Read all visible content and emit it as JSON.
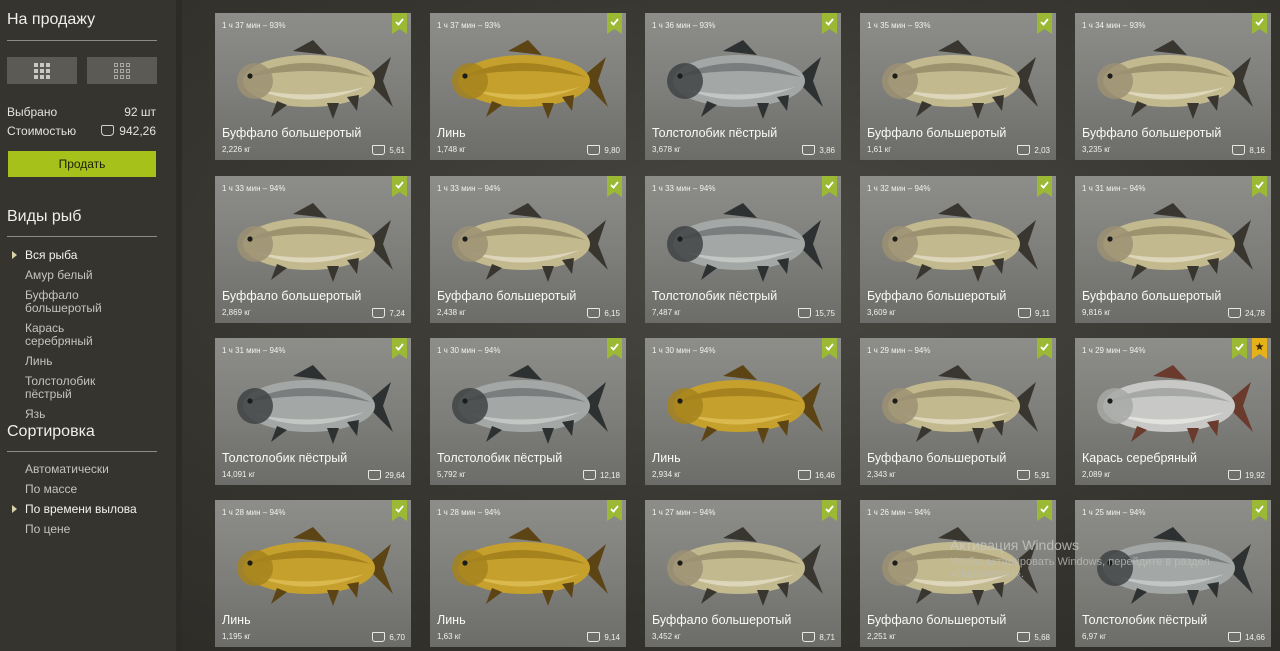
{
  "sidebar": {
    "for_sale_title": "На продажу",
    "selected_label": "Выбрано",
    "selected_value": "92 шт",
    "cost_label": "Стоимостью",
    "cost_value": "942,26",
    "sell_button": "Продать",
    "fish_types_title": "Виды рыб",
    "fish_types": [
      {
        "label": "Вся рыба",
        "active": true
      },
      {
        "label": "Амур белый",
        "active": false
      },
      {
        "label": "Буффало большеротый",
        "active": false
      },
      {
        "label": "Карась серебряный",
        "active": false
      },
      {
        "label": "Линь",
        "active": false
      },
      {
        "label": "Толстолобик пёстрый",
        "active": false
      },
      {
        "label": "Язь",
        "active": false
      }
    ],
    "sort_title": "Сортировка",
    "sort_options": [
      {
        "label": "Автоматически",
        "active": false
      },
      {
        "label": "По массе",
        "active": false
      },
      {
        "label": "По времени вылова",
        "active": true
      },
      {
        "label": "По цене",
        "active": false
      }
    ]
  },
  "colors": {
    "accent": "#a7c11b",
    "badge_check": "#9bb934",
    "badge_star": "#e5b21a"
  },
  "icons": {
    "view_compact": "grid-3x3-filled-icon",
    "view_list": "grid-3x3-outline-icon",
    "coin": "coin-stack-icon",
    "check": "check-icon",
    "star": "star-icon"
  },
  "cards": [
    {
      "time": "1 ч 37 мин – 93%",
      "name": "Буффало большеротый",
      "weight": "2,226 кг",
      "price": "5,61",
      "fish": "buffalo",
      "star": false
    },
    {
      "time": "1 ч 37 мин – 93%",
      "name": "Линь",
      "weight": "1,748 кг",
      "price": "9,80",
      "fish": "tench",
      "star": false
    },
    {
      "time": "1 ч 36 мин – 93%",
      "name": "Толстолобик пёстрый",
      "weight": "3,678 кг",
      "price": "3,86",
      "fish": "carp",
      "star": false
    },
    {
      "time": "1 ч 35 мин – 93%",
      "name": "Буффало большеротый",
      "weight": "1,61 кг",
      "price": "2,03",
      "fish": "buffalo",
      "star": false
    },
    {
      "time": "1 ч 34 мин – 93%",
      "name": "Буффало большеротый",
      "weight": "3,235 кг",
      "price": "8,16",
      "fish": "buffalo",
      "star": false
    },
    {
      "time": "1 ч 33 мин – 94%",
      "name": "Буффало большеротый",
      "weight": "2,869 кг",
      "price": "7,24",
      "fish": "buffalo",
      "star": false
    },
    {
      "time": "1 ч 33 мин – 94%",
      "name": "Буффало большеротый",
      "weight": "2,438 кг",
      "price": "6,15",
      "fish": "buffalo",
      "star": false
    },
    {
      "time": "1 ч 33 мин – 94%",
      "name": "Толстолобик пёстрый",
      "weight": "7,487 кг",
      "price": "15,75",
      "fish": "carp",
      "star": false
    },
    {
      "time": "1 ч 32 мин – 94%",
      "name": "Буффало большеротый",
      "weight": "3,609 кг",
      "price": "9,11",
      "fish": "buffalo",
      "star": false
    },
    {
      "time": "1 ч 31 мин – 94%",
      "name": "Буффало большеротый",
      "weight": "9,816 кг",
      "price": "24,78",
      "fish": "buffalo",
      "star": false
    },
    {
      "time": "1 ч 31 мин – 94%",
      "name": "Толстолобик пёстрый",
      "weight": "14,091 кг",
      "price": "29,64",
      "fish": "carp",
      "star": false
    },
    {
      "time": "1 ч 30 мин – 94%",
      "name": "Толстолобик пёстрый",
      "weight": "5,792 кг",
      "price": "12,18",
      "fish": "carp",
      "star": false
    },
    {
      "time": "1 ч 30 мин – 94%",
      "name": "Линь",
      "weight": "2,934 кг",
      "price": "16,46",
      "fish": "tench",
      "star": false
    },
    {
      "time": "1 ч 29 мин – 94%",
      "name": "Буффало большеротый",
      "weight": "2,343 кг",
      "price": "5,91",
      "fish": "buffalo",
      "star": false
    },
    {
      "time": "1 ч 29 мин – 94%",
      "name": "Карась серебряный",
      "weight": "2,089 кг",
      "price": "19,92",
      "fish": "crucian",
      "star": true
    },
    {
      "time": "1 ч 28 мин – 94%",
      "name": "Линь",
      "weight": "1,195 кг",
      "price": "6,70",
      "fish": "tench",
      "star": false
    },
    {
      "time": "1 ч 28 мин – 94%",
      "name": "Линь",
      "weight": "1,63 кг",
      "price": "9,14",
      "fish": "tench",
      "star": false
    },
    {
      "time": "1 ч 27 мин – 94%",
      "name": "Буффало большеротый",
      "weight": "3,452 кг",
      "price": "8,71",
      "fish": "buffalo",
      "star": false
    },
    {
      "time": "1 ч 26 мин – 94%",
      "name": "Буффало большеротый",
      "weight": "2,251 кг",
      "price": "5,68",
      "fish": "buffalo",
      "star": false
    },
    {
      "time": "1 ч 25 мин – 94%",
      "name": "Толстолобик пёстрый",
      "weight": "6,97 кг",
      "price": "14,66",
      "fish": "carp",
      "star": false
    }
  ],
  "overlay": {
    "activation_title": "Активация Windows",
    "activation_sub": "Чтобы активировать Windows, перейдите в раздел «Параметры»."
  }
}
